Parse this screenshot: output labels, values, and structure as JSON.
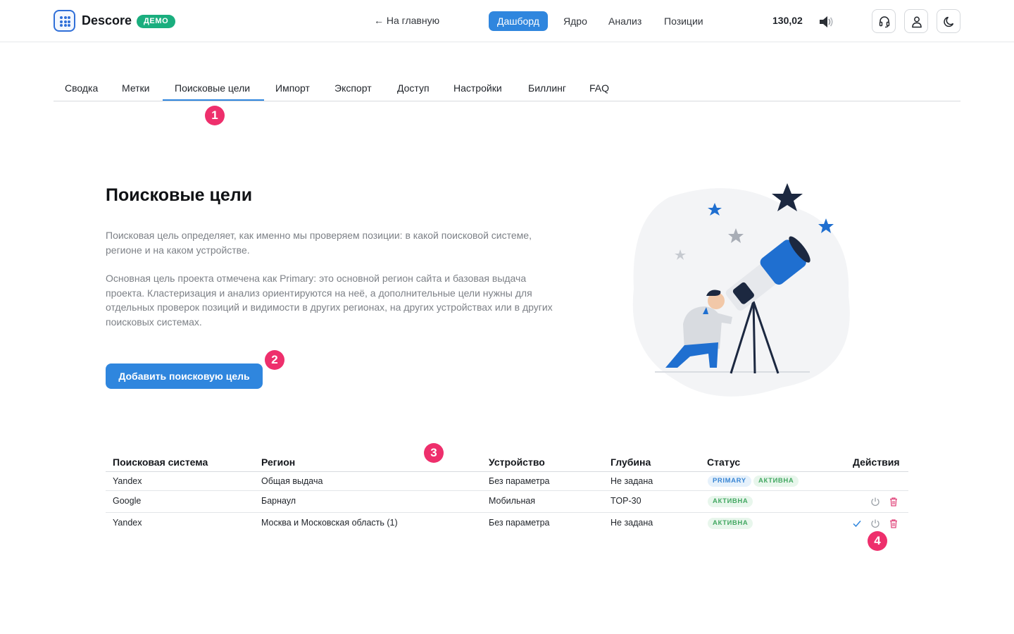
{
  "header": {
    "brand": "Descore",
    "demo_badge": "ДЕМО",
    "home_link": "← На главную",
    "nav": [
      "Дашборд",
      "Ядро",
      "Анализ",
      "Позиции"
    ],
    "balance": "130,02"
  },
  "tabs": [
    "Сводка",
    "Метки",
    "Поисковые цели",
    "Импорт",
    "Экспорт",
    "Доступ",
    "Настройки",
    "Биллинг",
    "FAQ"
  ],
  "active_tab": "Поисковые цели",
  "markers": [
    "1",
    "2",
    "3",
    "4"
  ],
  "intro": {
    "title": "Поисковые цели",
    "paragraph1": "Поисковая цель определяет, как именно мы проверяем позиции: в какой поисковой системе, регионе и на каком устройстве.",
    "paragraph2": "Основная цель проекта отмечена как Primary: это основной регион сайта и базовая выдача проекта. Кластеризация и анализ ориентируются на неё, а дополнительные цели нужны для отдельных проверок позиций и видимости в других регионах, на других устройствах или в других поисковых системах.",
    "add_button": "Добавить поисковую цель"
  },
  "table": {
    "columns": [
      "Поисковая система",
      "Регион",
      "Устройство",
      "Глубина",
      "Статус",
      "Действия"
    ],
    "rows": [
      {
        "engine": "Yandex",
        "region": "Общая выдача",
        "device": "Без параметра",
        "depth": "Не задана",
        "primary": "PRIMARY",
        "status": "АКТИВНА"
      },
      {
        "engine": "Google",
        "region": "Барнаул",
        "device": "Мобильная",
        "depth": "TOP-30",
        "status": "АКТИВНА"
      },
      {
        "engine": "Yandex",
        "region": "Москва и Московская область (1)",
        "device": "Без параметра",
        "depth": "Не задана",
        "status": "АКТИВНА"
      }
    ]
  },
  "colors": {
    "accent": "#2f86de",
    "demo_badge": "#1aae7e",
    "marker": "#ee2f6c",
    "delete": "#e0457b"
  },
  "icons": [
    "grid-logo-icon",
    "speaker-icon",
    "headset-icon",
    "user-icon",
    "moon-icon",
    "check-icon",
    "power-icon",
    "trash-icon"
  ]
}
